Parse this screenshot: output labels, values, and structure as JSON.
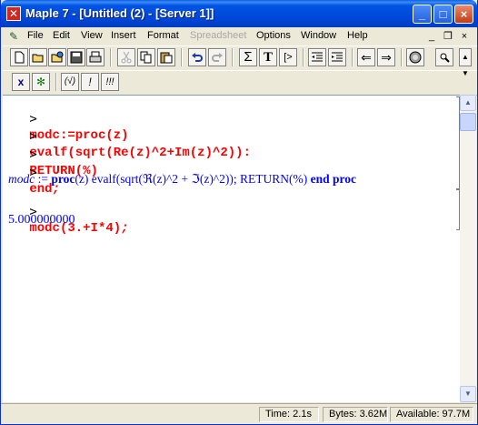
{
  "window": {
    "title": "Maple 7  - [Untitled (2) - [Server 1]]",
    "app_icon": "maple-leaf-icon"
  },
  "title_buttons": {
    "minimize": "_",
    "maximize": "□",
    "close": "×"
  },
  "menu": {
    "items": [
      "File",
      "Edit",
      "View",
      "Insert",
      "Format",
      "Spreadsheet",
      "Options",
      "Window",
      "Help"
    ],
    "disabled": [
      "Spreadsheet"
    ],
    "mdi_minimize": "_",
    "mdi_restore": "❐",
    "mdi_close": "×"
  },
  "toolbar1": {
    "icons": [
      "new-document-icon",
      "open-icon",
      "open-url-icon",
      "save-icon",
      "print-icon",
      "cut-icon",
      "copy-icon",
      "paste-icon",
      "undo-icon",
      "redo-icon",
      "sum-icon",
      "text-icon",
      "prompt-icon",
      "outdent-icon",
      "indent-icon",
      "back-icon",
      "forward-icon",
      "stop-icon",
      "zoom-icon"
    ],
    "sum_glyph": "Σ",
    "text_glyph": "T",
    "prompt_glyph": "[>",
    "back_glyph": "⇐",
    "forward_glyph": "⇒"
  },
  "toolbar2": {
    "x_label": "x",
    "leaf_glyph": "✻",
    "sqrt_label": "(√)",
    "bang_label": "!",
    "bangs_label": "!!!"
  },
  "worksheet": {
    "prompt": ">",
    "input1": {
      "line1": "modc:=proc(z)",
      "line2": "evalf(sqrt(Re(z)^2+Im(z)^2)):",
      "line3": "RETURN(%)",
      "line4_pre": "end",
      "line4_post": ";"
    },
    "output1": {
      "name": "modc",
      "assign": " := ",
      "kw_proc": "proc",
      "arg": "(z)",
      "body1": " evalf(sqrt(",
      "re": "ℜ",
      "body2": "(z)^2 + ",
      "im": "ℑ",
      "body3": "(z)^2)); RETURN(%) ",
      "kw_end": "end proc"
    },
    "input2": {
      "text": "modc(3.+I*4)",
      "semi": ";"
    },
    "output2": "5.000000000"
  },
  "status": {
    "time": "Time:  2.1s",
    "bytes": "Bytes: 3.62M",
    "available": "Available: 97.7M"
  }
}
